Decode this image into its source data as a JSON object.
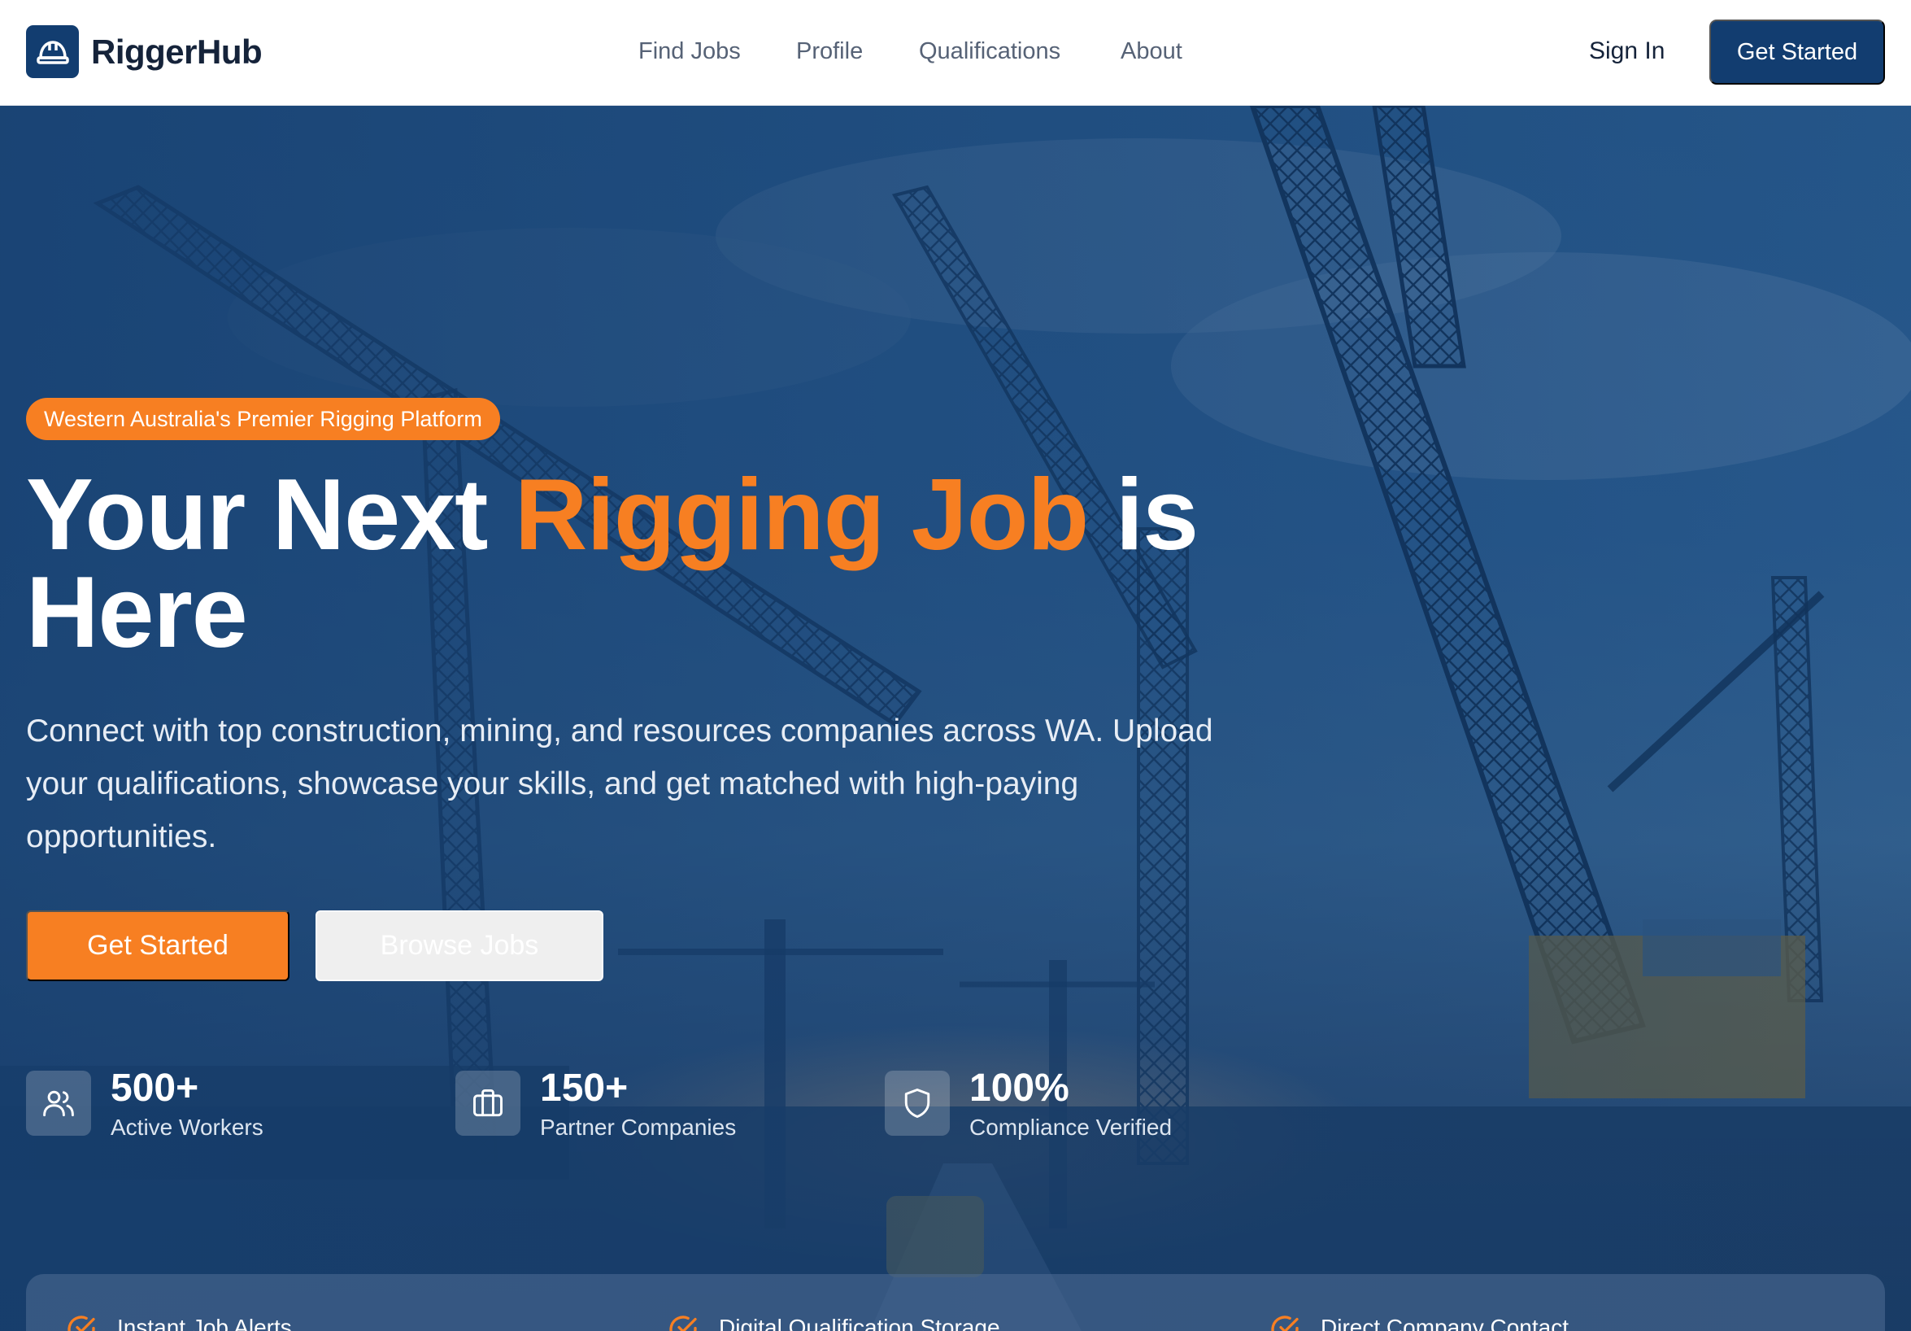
{
  "brand": {
    "name": "RiggerHub",
    "logo_icon": "hard-hat-icon"
  },
  "nav": {
    "links": [
      "Find Jobs",
      "Profile",
      "Qualifications",
      "About"
    ],
    "sign_in": "Sign In",
    "cta": "Get Started"
  },
  "hero": {
    "badge": "Western Australia's Premier Rigging Platform",
    "headline_pre": "Your Next ",
    "headline_accent": "Rigging Job",
    "headline_post": " is Here",
    "subcopy": "Connect with top construction, mining, and resources companies across WA. Upload your qualifications, showcase your skills, and get matched with high-paying opportunities.",
    "primary_button": "Get Started",
    "secondary_button": "Browse Jobs"
  },
  "stats": [
    {
      "value": "500+",
      "label": "Active Workers",
      "icon": "users-icon"
    },
    {
      "value": "150+",
      "label": "Partner Companies",
      "icon": "briefcase-icon"
    },
    {
      "value": "100%",
      "label": "Compliance Verified",
      "icon": "shield-icon"
    }
  ],
  "features": [
    {
      "label": "Instant Job Alerts",
      "icon": "check-circle-icon"
    },
    {
      "label": "Digital Qualification Storage",
      "icon": "check-circle-icon"
    },
    {
      "label": "Direct Company Contact",
      "icon": "check-circle-icon"
    }
  ],
  "colors": {
    "primary": "#123d70",
    "accent": "#f77f22",
    "text_dark": "#15233a",
    "nav_link": "#566276"
  }
}
